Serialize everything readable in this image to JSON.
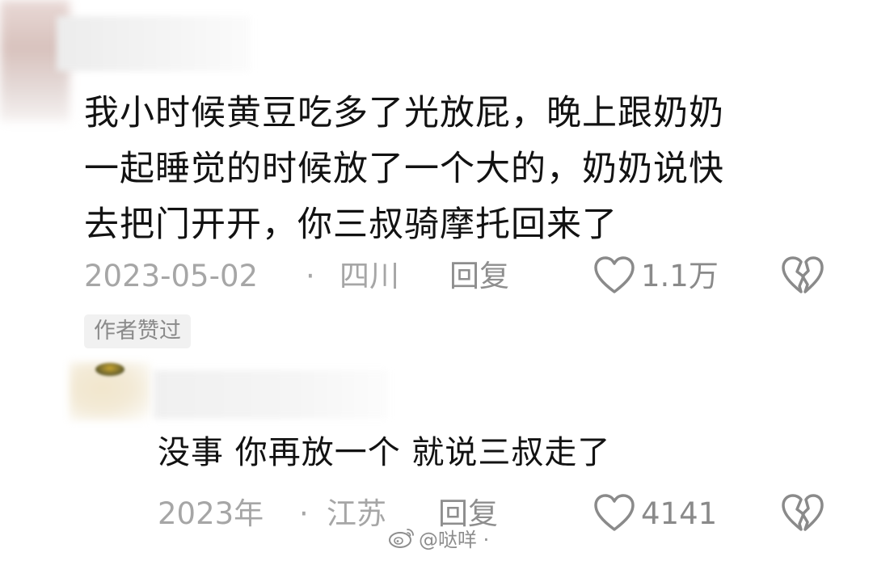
{
  "comment": {
    "text_lines": [
      "我小时候黄豆吃多了光放屁，晚上跟奶奶",
      "一起睡觉的时候放了一个大的，奶奶说快",
      "去把门开开，你三叔骑摩托回来了"
    ],
    "date": "2023-05-02",
    "separator": "·",
    "region": "四川",
    "reply_label": "回复",
    "like_count": "1.1万",
    "author_badge": "作者赞过"
  },
  "reply": {
    "text": "没事 你再放一个 就说三叔走了",
    "date": "2023年",
    "separator": "·",
    "region": "江苏",
    "reply_label": "回复",
    "like_count": "4141"
  },
  "watermark": {
    "text": "@哒咩 ·",
    "icon": "weibo-logo"
  },
  "colors": {
    "text_primary": "#121212",
    "text_meta": "#a6a6a6",
    "badge_bg": "#f1f1f1"
  },
  "icons": [
    "heart-outline-icon",
    "broken-heart-icon"
  ]
}
